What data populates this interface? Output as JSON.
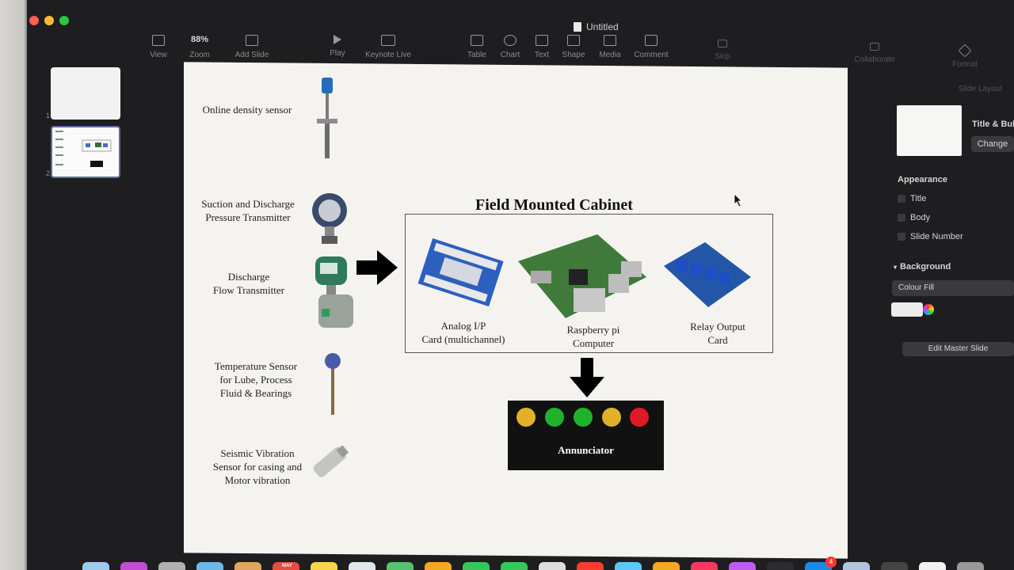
{
  "window": {
    "title": "Untitled",
    "traffic_colors": [
      "#ff5f57",
      "#febc2e",
      "#28c840"
    ]
  },
  "toolbar": {
    "items": [
      {
        "label": "View",
        "icon": "sidebar-icon"
      },
      {
        "label": "Zoom",
        "value": "88%",
        "icon": "zoom-icon"
      },
      {
        "label": "Add Slide",
        "icon": "add-slide-icon"
      },
      {
        "label": "Play",
        "icon": "play-icon"
      },
      {
        "label": "Keynote Live",
        "icon": "keynote-live-icon"
      },
      {
        "label": "Table",
        "icon": "table-icon"
      },
      {
        "label": "Chart",
        "icon": "chart-icon"
      },
      {
        "label": "Text",
        "icon": "text-icon"
      },
      {
        "label": "Shape",
        "icon": "shape-icon"
      },
      {
        "label": "Media",
        "icon": "media-icon"
      },
      {
        "label": "Comment",
        "icon": "comment-icon"
      },
      {
        "label": "Skip",
        "icon": "skip-icon"
      },
      {
        "label": "Collaborate",
        "icon": "collaborate-icon"
      },
      {
        "label": "Format",
        "icon": "format-icon"
      }
    ]
  },
  "navigator": {
    "slides": [
      {
        "number": "1"
      },
      {
        "number": "2"
      }
    ]
  },
  "slide": {
    "sensors": [
      {
        "label": "Online density sensor"
      },
      {
        "label": "Suction and Discharge\nPressure Transmitter"
      },
      {
        "label": "Discharge\nFlow Transmitter"
      },
      {
        "label": "Temperature Sensor\nfor Lube, Process\nFluid & Bearings"
      },
      {
        "label": "Seismic Vibration\nSensor for casing and\nMotor vibration"
      }
    ],
    "cabinet_title": "Field Mounted Cabinet",
    "cabinet_items": [
      {
        "label": "Analog I/P\nCard (multichannel)"
      },
      {
        "label": "Raspberry pi\nComputer"
      },
      {
        "label": "Relay Output\nCard"
      }
    ],
    "annunciator": {
      "label": "Annunciator",
      "lamp_colors": [
        "#e2b12a",
        "#1fb32c",
        "#1fb32c",
        "#e2b12a",
        "#e01a24"
      ]
    }
  },
  "inspector": {
    "layout_title": "Slide Layout",
    "master_name": "Title & Bullets",
    "change_button": "Change",
    "appearance_heading": "Appearance",
    "options": [
      {
        "label": "Title"
      },
      {
        "label": "Body"
      },
      {
        "label": "Slide Number"
      }
    ],
    "background_heading": "Background",
    "fill_type": "Colour Fill",
    "edit_master_button": "Edit Master Slide"
  },
  "dock": {
    "badge": "4",
    "calendar_month": "MAY",
    "icon_colors": [
      "#9ec9ef",
      "#c04fd1",
      "#b0b0b0",
      "#6fb7e8",
      "#e1a65a",
      "#e74c3c",
      "#f7d54a",
      "#dfe6ee",
      "#58c26b",
      "#f5a623",
      "#34c759",
      "#34c759",
      "#dedede",
      "#ff3b30",
      "#5ac8fa",
      "#f5a623",
      "#ff375f",
      "#bf5af2",
      "#2c2c2e",
      "#1e88e5",
      "#b0c4de",
      "#444",
      "#f2f2f2",
      "#999"
    ]
  }
}
